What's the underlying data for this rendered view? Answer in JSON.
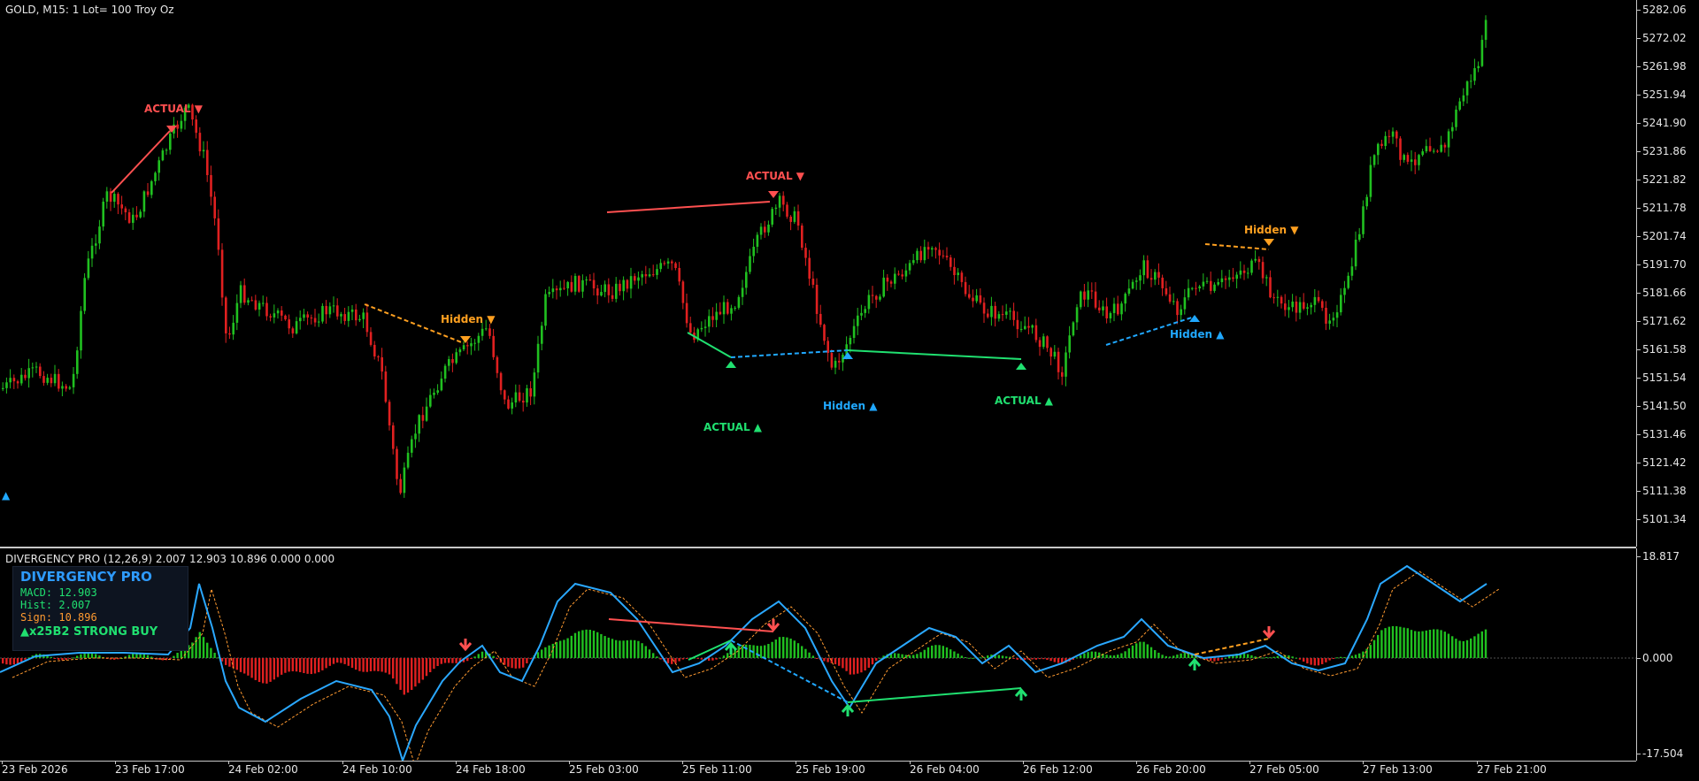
{
  "window": {
    "title": "GOLD, M15:  1 Lot= 100 Troy Oz",
    "indicator_title": "DIVERGENCY PRO (12,26,9) 2.007 12.903 10.896 0.000 0.000"
  },
  "price_axis": {
    "labels": [
      "5282.06",
      "5272.02",
      "5261.98",
      "5251.94",
      "5241.90",
      "5231.86",
      "5221.82",
      "5211.78",
      "5201.74",
      "5191.70",
      "5181.66",
      "5171.62",
      "5161.58",
      "5151.54",
      "5141.50",
      "5131.46",
      "5121.42",
      "5111.38",
      "5101.34"
    ]
  },
  "indicator_axis": {
    "labels": [
      "18.817",
      "0.000",
      "-17.504"
    ]
  },
  "time_axis": {
    "labels": [
      "23 Feb 2026",
      "23 Feb 17:00",
      "24 Feb 02:00",
      "24 Feb 10:00",
      "24 Feb 18:00",
      "25 Feb 03:00",
      "25 Feb 11:00",
      "25 Feb 19:00",
      "26 Feb 04:00",
      "26 Feb 12:00",
      "26 Feb 20:00",
      "27 Feb 05:00",
      "27 Feb 13:00",
      "27 Feb 21:00"
    ]
  },
  "info_panel": {
    "title": "DIVERGENCY PRO",
    "macd": "MACD: 12.903",
    "hist": "Hist: 2.007",
    "sign": "Sign: 10.896",
    "status": "▲x25B2 STRONG BUY"
  },
  "signals": [
    {
      "text": "ACTUAL ▼",
      "kind": "actual-bear"
    },
    {
      "text": "Hidden ▼",
      "kind": "hidden-bear"
    },
    {
      "text": "ACTUAL ▼",
      "kind": "actual-bear"
    },
    {
      "text": "ACTUAL ▲",
      "kind": "actual-bull"
    },
    {
      "text": "Hidden ▲",
      "kind": "hidden-bull"
    },
    {
      "text": "ACTUAL ▲",
      "kind": "actual-bull"
    },
    {
      "text": "Hidden ▲",
      "kind": "hidden-bull"
    },
    {
      "text": "Hidden ▼",
      "kind": "hidden-bear"
    },
    {
      "text": "▲",
      "kind": "hidden-bull"
    }
  ],
  "colors": {
    "bull_candle": "#20c020",
    "bear_candle": "#e02020",
    "actual_bear": "#ff5050",
    "hidden_bear": "#ffa020",
    "actual_bull": "#20e070",
    "hidden_bull": "#20a8ff",
    "macd_line": "#2aa8ff",
    "signal_line": "#ff9a30"
  }
}
